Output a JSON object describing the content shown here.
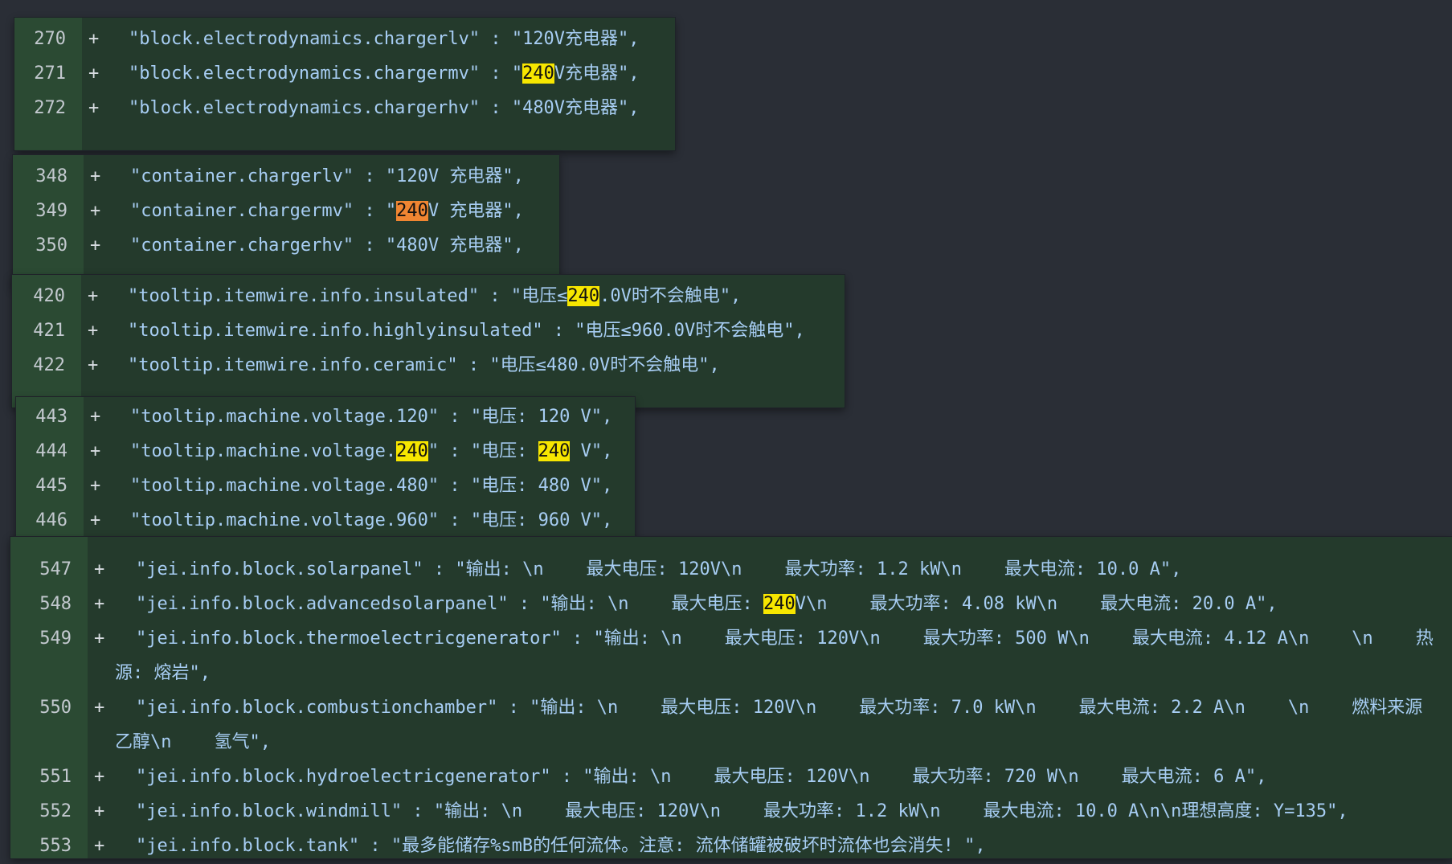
{
  "colors": {
    "page_bg": "#2a2e36",
    "hunk_bg": "#243a2c",
    "gutter_bg": "#2b4a33",
    "text": "#a7cdf3",
    "line_number": "#c3c9cf",
    "highlight_yellow": "#f7e600",
    "highlight_orange": "#f08632"
  },
  "hunks": [
    {
      "lines": [
        {
          "num": "270",
          "sign": "+",
          "parts": [
            {
              "t": "\"block.electrodynamics.chargerlv\" : \"120V充电器\","
            }
          ]
        },
        {
          "num": "271",
          "sign": "+",
          "parts": [
            {
              "t": "\"block.electrodynamics.chargermv\" : \""
            },
            {
              "t": "240",
              "hl": "yellow"
            },
            {
              "t": "V充电器\","
            }
          ]
        },
        {
          "num": "272",
          "sign": "+",
          "parts": [
            {
              "t": "\"block.electrodynamics.chargerhv\" : \"480V充电器\","
            }
          ]
        }
      ]
    },
    {
      "lines": [
        {
          "num": "348",
          "sign": "+",
          "parts": [
            {
              "t": "\"container.chargerlv\" : \"120V 充电器\","
            }
          ]
        },
        {
          "num": "349",
          "sign": "+",
          "parts": [
            {
              "t": "\"container.chargermv\" : \""
            },
            {
              "t": "240",
              "hl": "orange"
            },
            {
              "t": "V 充电器\","
            }
          ]
        },
        {
          "num": "350",
          "sign": "+",
          "parts": [
            {
              "t": "\"container.chargerhv\" : \"480V 充电器\","
            }
          ]
        }
      ]
    },
    {
      "lines": [
        {
          "num": "420",
          "sign": "+",
          "parts": [
            {
              "t": "\"tooltip.itemwire.info.insulated\" : \"电压≤"
            },
            {
              "t": "240",
              "hl": "yellow"
            },
            {
              "t": ".0V时不会触电\","
            }
          ]
        },
        {
          "num": "421",
          "sign": "+",
          "parts": [
            {
              "t": "\"tooltip.itemwire.info.highlyinsulated\" : \"电压≤960.0V时不会触电\","
            }
          ]
        },
        {
          "num": "422",
          "sign": "+",
          "parts": [
            {
              "t": "\"tooltip.itemwire.info.ceramic\" : \"电压≤480.0V时不会触电\","
            }
          ]
        }
      ]
    },
    {
      "lines": [
        {
          "num": "443",
          "sign": "+",
          "parts": [
            {
              "t": "\"tooltip.machine.voltage.120\" : \"电压: 120 V\","
            }
          ]
        },
        {
          "num": "444",
          "sign": "+",
          "parts": [
            {
              "t": "\"tooltip.machine.voltage."
            },
            {
              "t": "240",
              "hl": "yellow"
            },
            {
              "t": "\" : \"电压: "
            },
            {
              "t": "240",
              "hl": "yellow"
            },
            {
              "t": " V\","
            }
          ]
        },
        {
          "num": "445",
          "sign": "+",
          "parts": [
            {
              "t": "\"tooltip.machine.voltage.480\" : \"电压: 480 V\","
            }
          ]
        },
        {
          "num": "446",
          "sign": "+",
          "parts": [
            {
              "t": "\"tooltip.machine.voltage.960\" : \"电压: 960 V\","
            }
          ]
        }
      ]
    },
    {
      "lines": [
        {
          "num": "547",
          "sign": "+",
          "parts": [
            {
              "t": "\"jei.info.block.solarpanel\" : \"输出: \\n    最大电压: 120V\\n    最大功率: 1.2 kW\\n    最大电流: 10.0 A\","
            }
          ]
        },
        {
          "num": "548",
          "sign": "+",
          "parts": [
            {
              "t": "\"jei.info.block.advancedsolarpanel\" : \"输出: \\n    最大电压: "
            },
            {
              "t": "240",
              "hl": "yellow"
            },
            {
              "t": "V\\n    最大功率: 4.08 kW\\n    最大电流: 20.0 A\","
            }
          ]
        },
        {
          "num": "549",
          "sign": "+",
          "parts": [
            {
              "t": "\"jei.info.block.thermoelectricgenerator\" : \"输出: \\n    最大电压: 120V\\n    最大功率: 500 W\\n    最大电流: 4.12 A\\n    \\n    热"
            }
          ],
          "cont": "源: 熔岩\","
        },
        {
          "num": "550",
          "sign": "+",
          "parts": [
            {
              "t": "\"jei.info.block.combustionchamber\" : \"输出: \\n    最大电压: 120V\\n    最大功率: 7.0 kW\\n    最大电流: 2.2 A\\n    \\n    燃料来源"
            }
          ],
          "cont": "乙醇\\n    氢气\","
        },
        {
          "num": "551",
          "sign": "+",
          "parts": [
            {
              "t": "\"jei.info.block.hydroelectricgenerator\" : \"输出: \\n    最大电压: 120V\\n    最大功率: 720 W\\n    最大电流: 6 A\","
            }
          ]
        },
        {
          "num": "552",
          "sign": "+",
          "parts": [
            {
              "t": "\"jei.info.block.windmill\" : \"输出: \\n    最大电压: 120V\\n    最大功率: 1.2 kW\\n    最大电流: 10.0 A\\n\\n理想高度: Y=135\","
            }
          ]
        },
        {
          "num": "553",
          "sign": "+",
          "parts": [
            {
              "t": "\"jei.info.block.tank\" : \"最多能储存%smB的任何流体。注意: 流体储罐被破坏时流体也会消失! \","
            }
          ]
        }
      ]
    }
  ]
}
